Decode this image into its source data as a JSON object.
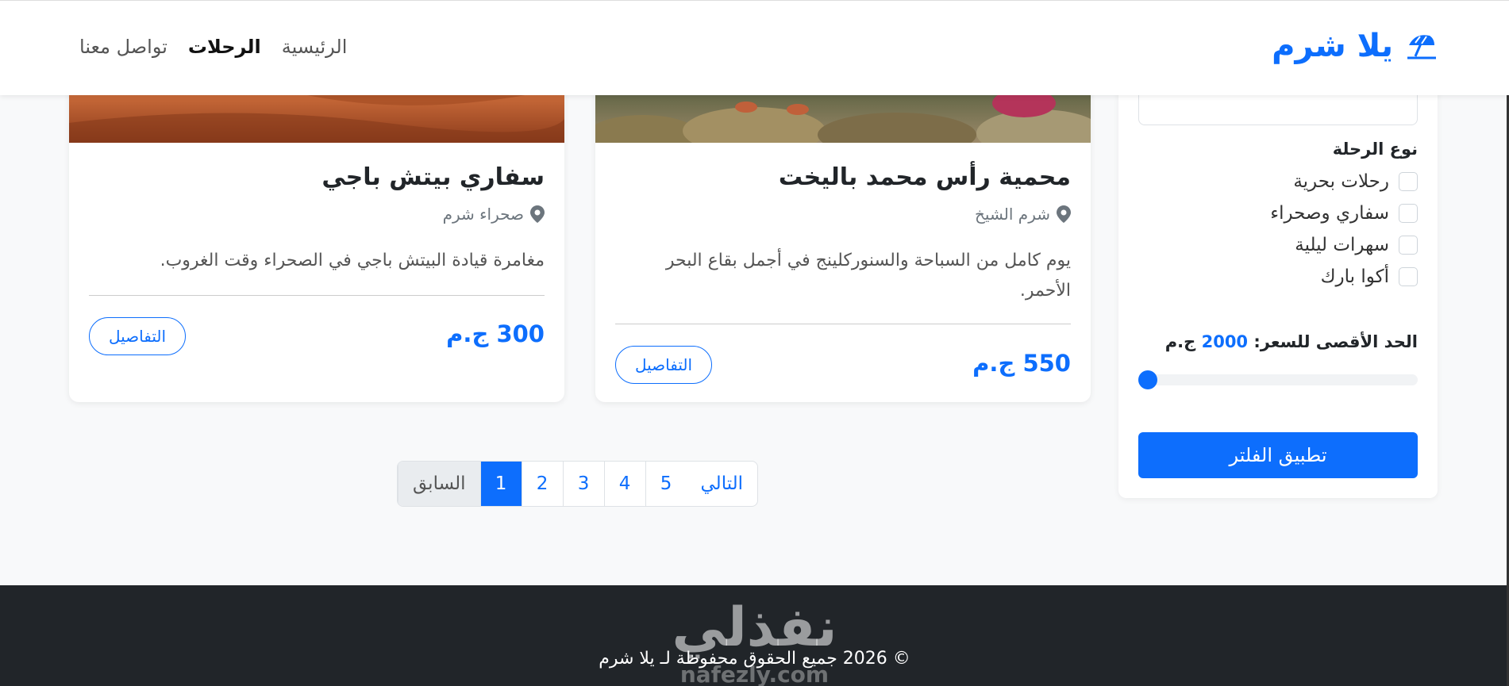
{
  "brand": {
    "name": "يلا شرم",
    "icon": "umbrella-beach-icon"
  },
  "nav": {
    "items": [
      "الرئيسية",
      "الرحلات",
      "تواصل معنا"
    ],
    "active_index": 1
  },
  "filter": {
    "type_title": "نوع الرحلة",
    "types": [
      "رحلات بحرية",
      "سفاري وصحراء",
      "سهرات ليلية",
      "أكوا بارك"
    ],
    "price_label": "الحد الأقصى للسعر:",
    "price_value": "2000",
    "price_unit": "ج.م",
    "price_fraction": 0,
    "apply_label": "تطبيق الفلتر"
  },
  "trips": [
    {
      "title": "محمية رأس محمد باليخت",
      "location": "شرم الشيخ",
      "description": "يوم كامل من السباحة والسنوركلينج في أجمل بقاع البحر الأحمر.",
      "price": "550 ج.م",
      "details_label": "التفاصيل"
    },
    {
      "title": "سفاري بيتش باجي",
      "location": "صحراء شرم",
      "description": "مغامرة قيادة البيتش باجي في الصحراء وقت الغروب.",
      "price": "300 ج.م",
      "details_label": "التفاصيل"
    }
  ],
  "pagination": {
    "prev": "السابق",
    "pages": [
      "1",
      "2",
      "3",
      "4",
      "5"
    ],
    "next": "التالي",
    "current": "1"
  },
  "footer": {
    "watermark": "نفذلي",
    "copyright": "© 2026 جميع الحقوق محفوظة لـ يلا شرم",
    "watermark_sub": "nafezly.com"
  },
  "colors": {
    "primary": "#0d6efd",
    "footer_bg": "#212529"
  }
}
